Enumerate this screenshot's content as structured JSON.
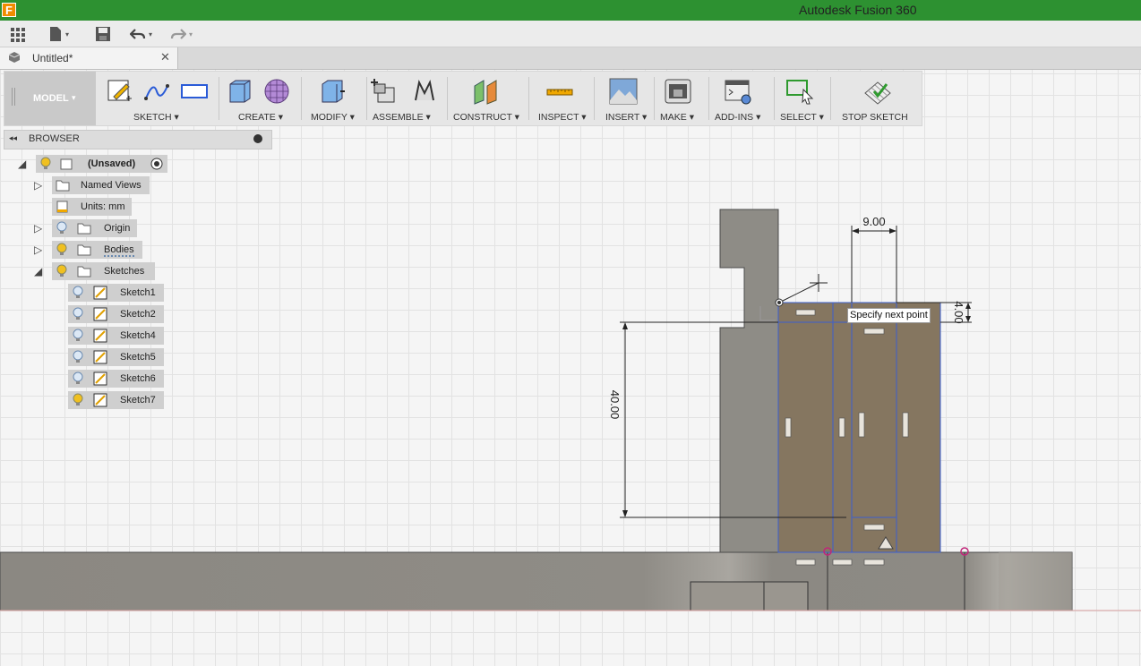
{
  "app": {
    "title": "Autodesk Fusion 360",
    "icon_letter": "F"
  },
  "quick_access": {
    "icons": [
      "grid-icon",
      "file-icon",
      "save-icon",
      "undo-icon",
      "redo-icon"
    ]
  },
  "document_tab": {
    "label": "Untitled*",
    "close": "✕"
  },
  "toolbar": {
    "workspace": "MODEL",
    "groups": [
      {
        "label": "SKETCH",
        "caret": "▾"
      },
      {
        "label": "CREATE",
        "caret": "▾"
      },
      {
        "label": "MODIFY",
        "caret": "▾"
      },
      {
        "label": "ASSEMBLE",
        "caret": "▾"
      },
      {
        "label": "CONSTRUCT",
        "caret": "▾"
      },
      {
        "label": "INSPECT",
        "caret": "▾"
      },
      {
        "label": "INSERT",
        "caret": "▾"
      },
      {
        "label": "MAKE",
        "caret": "▾"
      },
      {
        "label": "ADD-INS",
        "caret": "▾"
      },
      {
        "label": "SELECT",
        "caret": "▾"
      },
      {
        "label": "STOP SKETCH",
        "caret": ""
      }
    ]
  },
  "browser": {
    "title": "BROWSER",
    "root": "(Unsaved)",
    "items": [
      {
        "label": "Named Views"
      },
      {
        "label": "Units: mm"
      },
      {
        "label": "Origin"
      },
      {
        "label": "Bodies"
      },
      {
        "label": "Sketches"
      }
    ],
    "sketches": [
      "Sketch1",
      "Sketch2",
      "Sketch4",
      "Sketch5",
      "Sketch6",
      "Sketch7"
    ]
  },
  "viewport": {
    "dimensions": [
      "9.00",
      "4.00",
      "40.00"
    ],
    "tooltip": "Specify next point",
    "colors": {
      "body": "#8e8c86",
      "sketch_fill": "#857660",
      "sketch_line": "#3c5fd0",
      "constraint_point": "#c0267a"
    }
  }
}
